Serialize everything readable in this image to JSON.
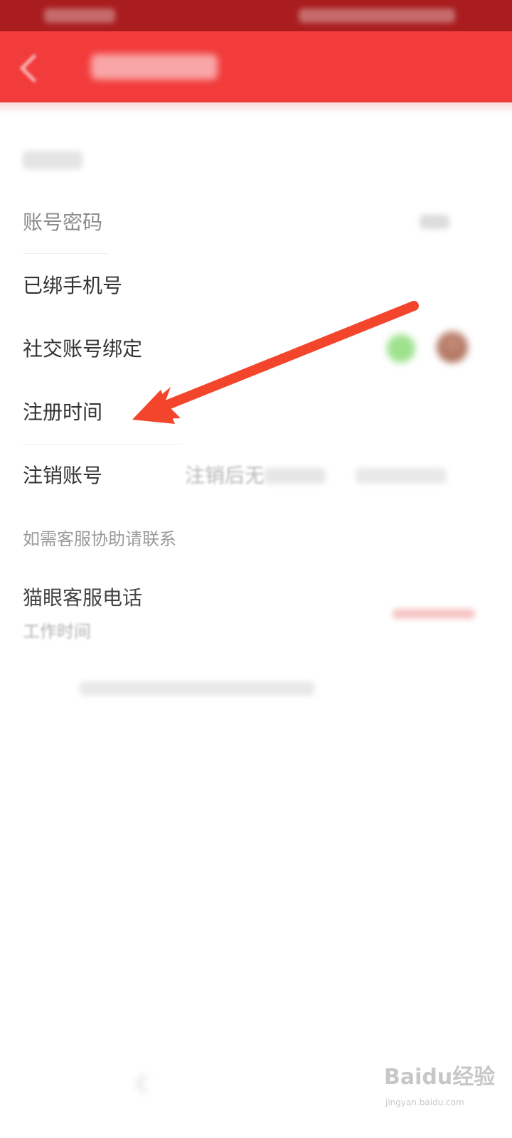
{
  "rows": {
    "account_password": "账号密码",
    "bound_phone": "已绑手机号",
    "social_binding": "社交账号绑定",
    "register_time": "注册时间",
    "cancel_account": "注销账号",
    "cancel_account_hint": "注销后无"
  },
  "support": {
    "help_hint": "如需客服协助请联系",
    "hotline_label": "猫眼客服电话",
    "work_hours_label": "工作时间"
  },
  "watermark": {
    "brand": "Baidu经验",
    "url": "jingyan.baidu.com"
  },
  "colors": {
    "status_bar": "#a91d1f",
    "app_bar": "#f23b3b",
    "arrow": "#f2452c",
    "label": "#333333",
    "secondary": "#9b9b9b"
  },
  "icons": {
    "back": "chevron-left-icon",
    "wechat": "wechat-icon",
    "avatar": "avatar"
  }
}
